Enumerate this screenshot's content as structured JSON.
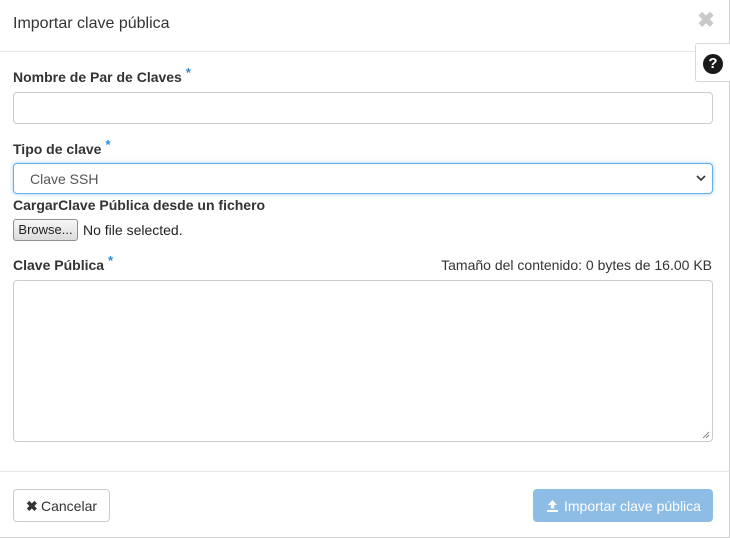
{
  "modal": {
    "title": "Importar clave pública",
    "close_icon": "close-icon",
    "help_icon": "question-circle-icon"
  },
  "form": {
    "keypair_name": {
      "label": "Nombre de Par de Claves",
      "required": "*",
      "value": "",
      "placeholder": ""
    },
    "key_type": {
      "label": "Tipo de clave",
      "required": "*",
      "selected": "Clave SSH",
      "options": [
        "Clave SSH"
      ]
    },
    "upload": {
      "label": "CargarClave Pública desde un fichero",
      "browse_label": "Browse...",
      "status": "No file selected."
    },
    "public_key": {
      "label": "Clave Pública",
      "required": "*",
      "size_info": "Tamaño del contenido: 0 bytes de 16.00 KB",
      "value": ""
    }
  },
  "footer": {
    "cancel_label": "Cancelar",
    "submit_label": "Importar clave pública",
    "submit_icon": "upload-icon",
    "cancel_icon": "x-icon"
  },
  "colors": {
    "accent": "#2a8bd8",
    "submit_disabled": "#8dbde4",
    "focus_border": "#66afe9"
  }
}
